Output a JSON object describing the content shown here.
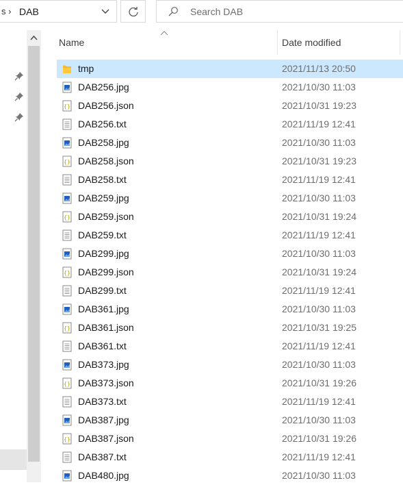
{
  "address_bar": {
    "separator": "s ›",
    "current_folder": "DAB"
  },
  "search": {
    "placeholder": "Search DAB"
  },
  "columns": {
    "name": "Name",
    "date_modified": "Date modified"
  },
  "files": [
    {
      "name": "tmp",
      "date": "2021/11/13 20:50",
      "icon": "folder-icon",
      "selected": true
    },
    {
      "name": "DAB256.jpg",
      "date": "2021/10/30 11:03",
      "icon": "image-file-icon"
    },
    {
      "name": "DAB256.json",
      "date": "2021/10/31 19:23",
      "icon": "json-file-icon"
    },
    {
      "name": "DAB256.txt",
      "date": "2021/11/19 12:41",
      "icon": "text-file-icon"
    },
    {
      "name": "DAB258.jpg",
      "date": "2021/10/30 11:03",
      "icon": "image-file-icon"
    },
    {
      "name": "DAB258.json",
      "date": "2021/10/31 19:23",
      "icon": "json-file-icon"
    },
    {
      "name": "DAB258.txt",
      "date": "2021/11/19 12:41",
      "icon": "text-file-icon"
    },
    {
      "name": "DAB259.jpg",
      "date": "2021/10/30 11:03",
      "icon": "image-file-icon"
    },
    {
      "name": "DAB259.json",
      "date": "2021/10/31 19:24",
      "icon": "json-file-icon"
    },
    {
      "name": "DAB259.txt",
      "date": "2021/11/19 12:41",
      "icon": "text-file-icon"
    },
    {
      "name": "DAB299.jpg",
      "date": "2021/10/30 11:03",
      "icon": "image-file-icon"
    },
    {
      "name": "DAB299.json",
      "date": "2021/10/31 19:24",
      "icon": "json-file-icon"
    },
    {
      "name": "DAB299.txt",
      "date": "2021/11/19 12:41",
      "icon": "text-file-icon"
    },
    {
      "name": "DAB361.jpg",
      "date": "2021/10/30 11:03",
      "icon": "image-file-icon"
    },
    {
      "name": "DAB361.json",
      "date": "2021/10/31 19:25",
      "icon": "json-file-icon"
    },
    {
      "name": "DAB361.txt",
      "date": "2021/11/19 12:41",
      "icon": "text-file-icon"
    },
    {
      "name": "DAB373.jpg",
      "date": "2021/10/30 11:03",
      "icon": "image-file-icon"
    },
    {
      "name": "DAB373.json",
      "date": "2021/10/31 19:26",
      "icon": "json-file-icon"
    },
    {
      "name": "DAB373.txt",
      "date": "2021/11/19 12:41",
      "icon": "text-file-icon"
    },
    {
      "name": "DAB387.jpg",
      "date": "2021/10/30 11:03",
      "icon": "image-file-icon"
    },
    {
      "name": "DAB387.json",
      "date": "2021/10/31 19:26",
      "icon": "json-file-icon"
    },
    {
      "name": "DAB387.txt",
      "date": "2021/11/19 12:41",
      "icon": "text-file-icon"
    },
    {
      "name": "DAB480.jpg",
      "date": "2021/10/30 11:03",
      "icon": "image-file-icon"
    }
  ],
  "colors": {
    "selection": "#cce8ff",
    "folder": "#ffc83d",
    "image_icon": "#1f5fbf",
    "json_icon": "#c8b400"
  }
}
